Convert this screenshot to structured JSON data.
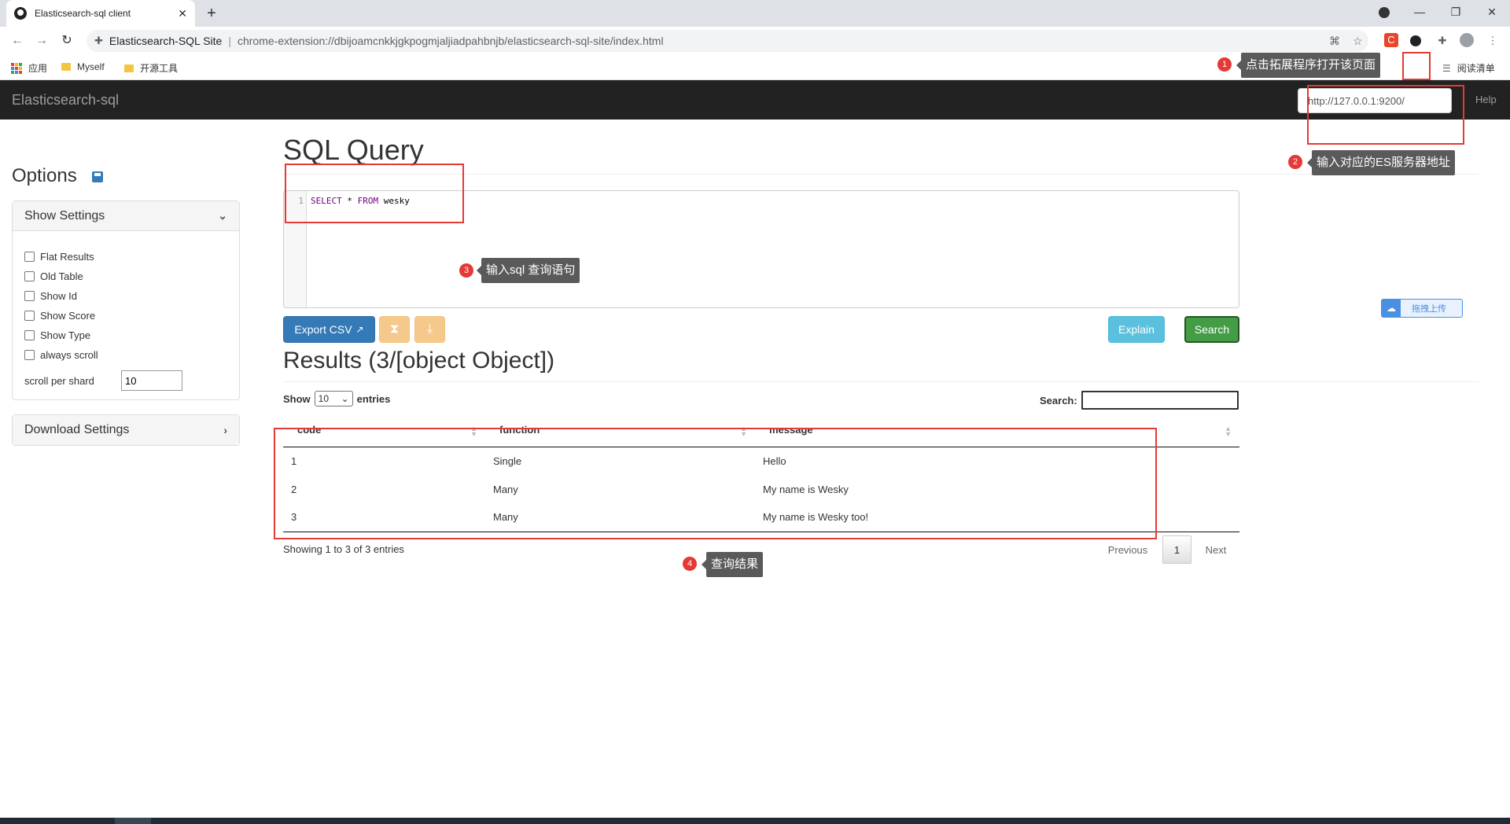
{
  "browser": {
    "tab_title": "Elasticsearch-sql client",
    "tab_close": "✕",
    "new_tab": "+",
    "omnibox_site": "Elasticsearch-SQL Site",
    "omnibox_sep": "|",
    "omnibox_url": "chrome-extension://dbijoamcnkkjgkpogmjaljiadpahbnjb/elasticsearch-sql-site/index.html",
    "extension_c_label": "C",
    "bookmarks": {
      "apps": "应用",
      "myself": "Myself",
      "open_source": "开源工具",
      "reading_list": "阅读清单"
    },
    "window_controls": {
      "minimize": "—",
      "restore": "❐",
      "close": "✕"
    }
  },
  "navbar": {
    "brand": "Elasticsearch-sql",
    "server_url": "http://127.0.0.1:9200/",
    "help": "Help"
  },
  "sidebar": {
    "title": "Options",
    "show_settings": {
      "heading": "Show Settings",
      "options": [
        "Flat Results",
        "Old Table",
        "Show Id",
        "Show Score",
        "Show Type",
        "always scroll"
      ],
      "scroll_label": "scroll per shard",
      "scroll_value": "10"
    },
    "download_settings": {
      "heading": "Download Settings"
    }
  },
  "query": {
    "title": "SQL Query",
    "line_number": "1",
    "code_kw1": "SELECT",
    "code_mid": " * ",
    "code_kw2": "FROM",
    "code_table": " wesky"
  },
  "actions": {
    "export_csv": "Export CSV",
    "explain": "Explain",
    "search": "Search"
  },
  "results": {
    "title": "Results (3/[object Object])",
    "show_label": "Show",
    "page_size": "10",
    "entries_label": "entries",
    "search_label": "Search:",
    "columns": [
      "code",
      "function",
      "message"
    ],
    "rows": [
      [
        "1",
        "Single",
        "Hello"
      ],
      [
        "2",
        "Many",
        "My name is Wesky"
      ],
      [
        "3",
        "Many",
        "My name is Wesky too!"
      ]
    ],
    "info": "Showing 1 to 3 of 3 entries",
    "pagination": {
      "previous": "Previous",
      "current": "1",
      "next": "Next"
    }
  },
  "annotations": [
    {
      "num": "1",
      "text": "点击拓展程序打开该页面"
    },
    {
      "num": "2",
      "text": "输入对应的ES服务器地址"
    },
    {
      "num": "3",
      "text": "输入sql 查询语句"
    },
    {
      "num": "4",
      "text": "查询结果"
    }
  ],
  "upload_widget": {
    "label": "拖拽上传"
  },
  "colors": {
    "navbar": "#222222",
    "primary": "#337ab7",
    "success": "#449d44",
    "info": "#5bc0de",
    "warning": "#f0ad4e",
    "annotation_red": "#e53935"
  }
}
